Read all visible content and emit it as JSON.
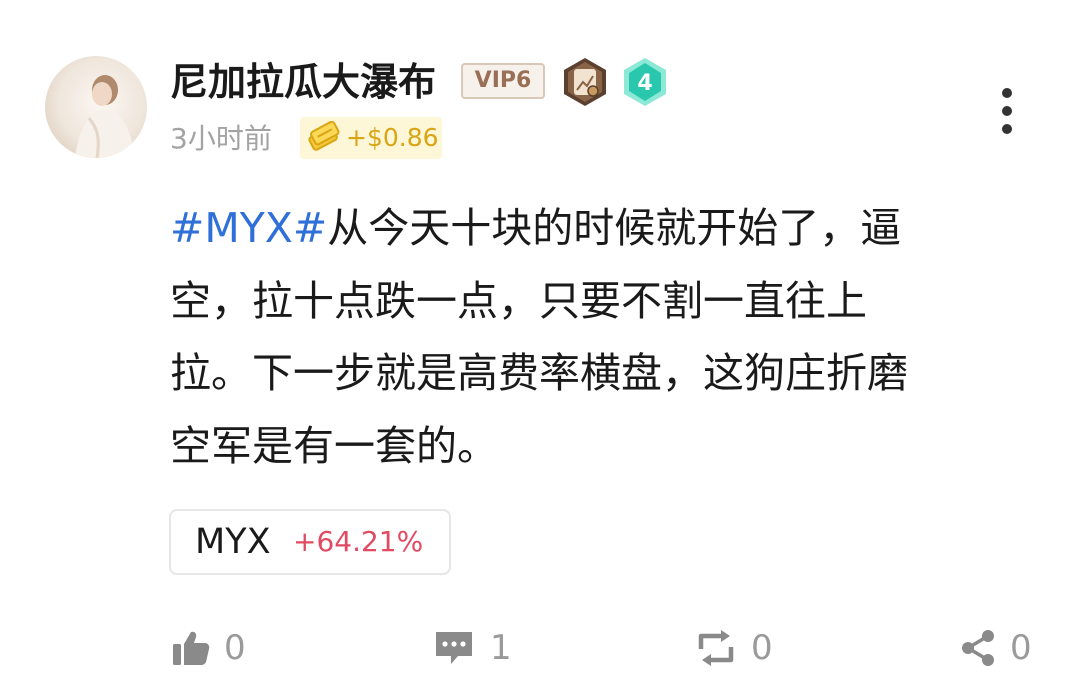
{
  "post": {
    "author": {
      "name": "尼加拉瓜大瀑布",
      "vip": "VIP6",
      "level": "4",
      "avatar_icon": "avatar-photo"
    },
    "time": "3小时前",
    "reward": "+$0.86",
    "content": {
      "hashtag": "#MYX#",
      "line1_rest": "从今天十块的时候就开始了，逼",
      "line2": "空，拉十点跌一点，只要不割一直往上",
      "line3": "拉。下一步就是高费率横盘，这狗庄折磨",
      "line4": "空军是有一套的。"
    },
    "coin": {
      "symbol": "MYX",
      "change": "+64.21%"
    },
    "actions": {
      "likes": "0",
      "comments": "1",
      "reposts": "0",
      "shares": "0"
    }
  },
  "colors": {
    "hashtag": "#2f6fd8",
    "change_up": "#e04a62",
    "reward_text": "#d9a514",
    "reward_bg": "#fdf7d7",
    "muted": "#9a9a9a"
  }
}
